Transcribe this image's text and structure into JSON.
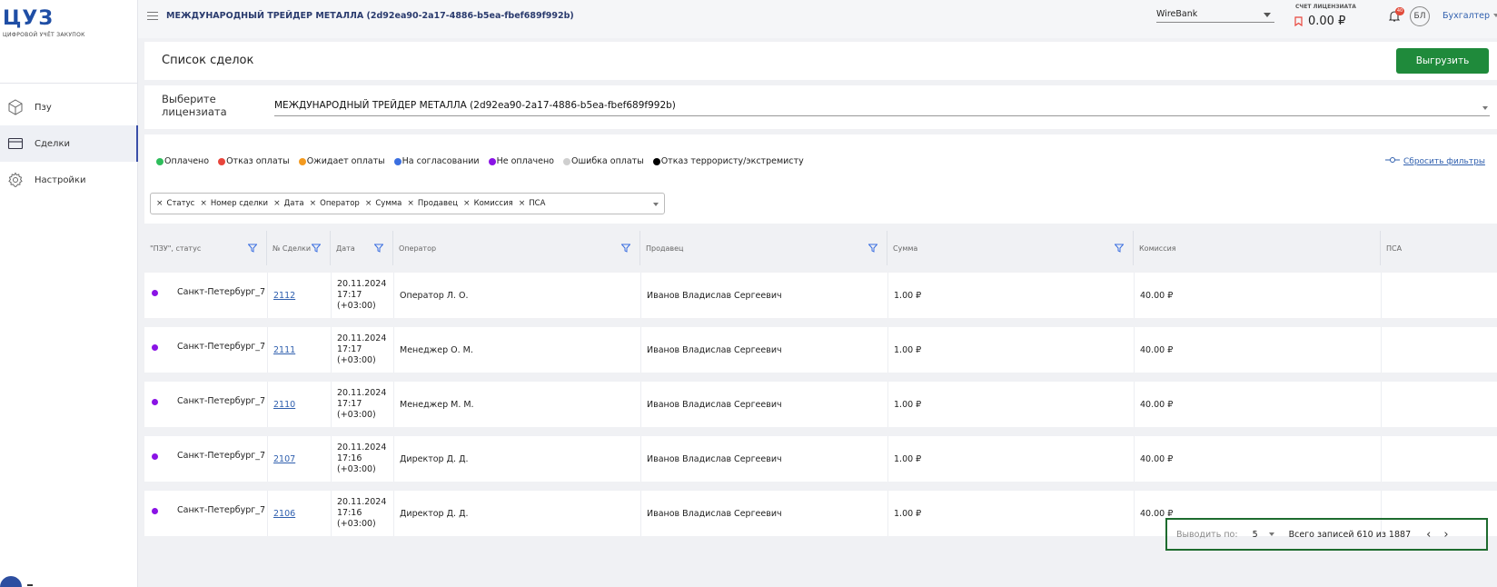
{
  "sidebar": {
    "logo_title": "ЦУЗ",
    "logo_subtitle": "ЦИФРОВОЙ УЧЁТ ЗАКУПОК",
    "items": [
      {
        "label": "Пзу",
        "icon": "box-icon"
      },
      {
        "label": "Сделки",
        "icon": "card-icon",
        "active": true
      },
      {
        "label": "Настройки",
        "icon": "gear-icon"
      }
    ]
  },
  "topbar": {
    "title": "МЕЖДУНАРОДНЫЙ ТРЕЙДЕР МЕТАЛЛА (2d92ea90-2a17-4886-b5ea-fbef689f992b)",
    "bank": "WireBank",
    "license_label": "СЧЕТ ЛИЦЕНЗИАТА",
    "license_amount": "0.00 ₽",
    "notifications_badge": "40",
    "avatar_initials": "БЛ",
    "role": "Бухгалтер"
  },
  "page": {
    "title": "Список сделок",
    "export_label": "Выгрузить",
    "licensee_label": "Выберите лицензиата",
    "licensee_value": "МЕЖДУНАРОДНЫЙ ТРЕЙДЕР МЕТАЛЛА (2d92ea90-2a17-4886-b5ea-fbef689f992b)",
    "reset_filters": "Сбросить фильтры"
  },
  "legend": [
    {
      "label": "Оплачено",
      "color": "#2ebd5b"
    },
    {
      "label": "Отказ оплаты",
      "color": "#e8453c"
    },
    {
      "label": "Ожидает оплаты",
      "color": "#f39a1f"
    },
    {
      "label": "На согласовании",
      "color": "#3b6fe0"
    },
    {
      "label": "Не оплачено",
      "color": "#8a13e5"
    },
    {
      "label": "Ошибка оплаты",
      "color": "#cfcfcf"
    },
    {
      "label": "Отказ террористу/экстремисту",
      "color": "#000000"
    }
  ],
  "column_chips": [
    "Статус",
    "Номер сделки",
    "Дата",
    "Оператор",
    "Сумма",
    "Продавец",
    "Комиссия",
    "ПСА"
  ],
  "table": {
    "headers": [
      "\"ПЗУ\", статус",
      "№ Сделки",
      "Дата",
      "Оператор",
      "Продавец",
      "Сумма",
      "Комиссия",
      "ПСА"
    ],
    "rows": [
      {
        "city": "Санкт-Петербург_7",
        "deal": "2112",
        "date": "20.11.2024",
        "time": "17:17",
        "tz": "(+03:00)",
        "operator": "Оператор Л. О.",
        "seller": "Иванов Владислав Сергеевич",
        "sum": "1.00 ₽",
        "commission": "40.00 ₽",
        "status_color": "#8a13e5"
      },
      {
        "city": "Санкт-Петербург_7",
        "deal": "2111",
        "date": "20.11.2024",
        "time": "17:17",
        "tz": "(+03:00)",
        "operator": "Менеджер О. М.",
        "seller": "Иванов Владислав Сергеевич",
        "sum": "1.00 ₽",
        "commission": "40.00 ₽",
        "status_color": "#8a13e5"
      },
      {
        "city": "Санкт-Петербург_7",
        "deal": "2110",
        "date": "20.11.2024",
        "time": "17:17",
        "tz": "(+03:00)",
        "operator": "Менеджер М. М.",
        "seller": "Иванов Владислав Сергеевич",
        "sum": "1.00 ₽",
        "commission": "40.00 ₽",
        "status_color": "#8a13e5"
      },
      {
        "city": "Санкт-Петербург_7",
        "deal": "2107",
        "date": "20.11.2024",
        "time": "17:16",
        "tz": "(+03:00)",
        "operator": "Директор Д. Д.",
        "seller": "Иванов Владислав Сергеевич",
        "sum": "1.00 ₽",
        "commission": "40.00 ₽",
        "status_color": "#8a13e5"
      },
      {
        "city": "Санкт-Петербург_7",
        "deal": "2106",
        "date": "20.11.2024",
        "time": "17:16",
        "tz": "(+03:00)",
        "operator": "Директор Д. Д.",
        "seller": "Иванов Владислав Сергеевич",
        "sum": "1.00 ₽",
        "commission": "40.00 ₽",
        "status_color": "#8a13e5"
      }
    ]
  },
  "pagination": {
    "per_page_label": "Выводить по:",
    "per_page_value": "5",
    "total": "Всего записей 610 из 1887"
  }
}
